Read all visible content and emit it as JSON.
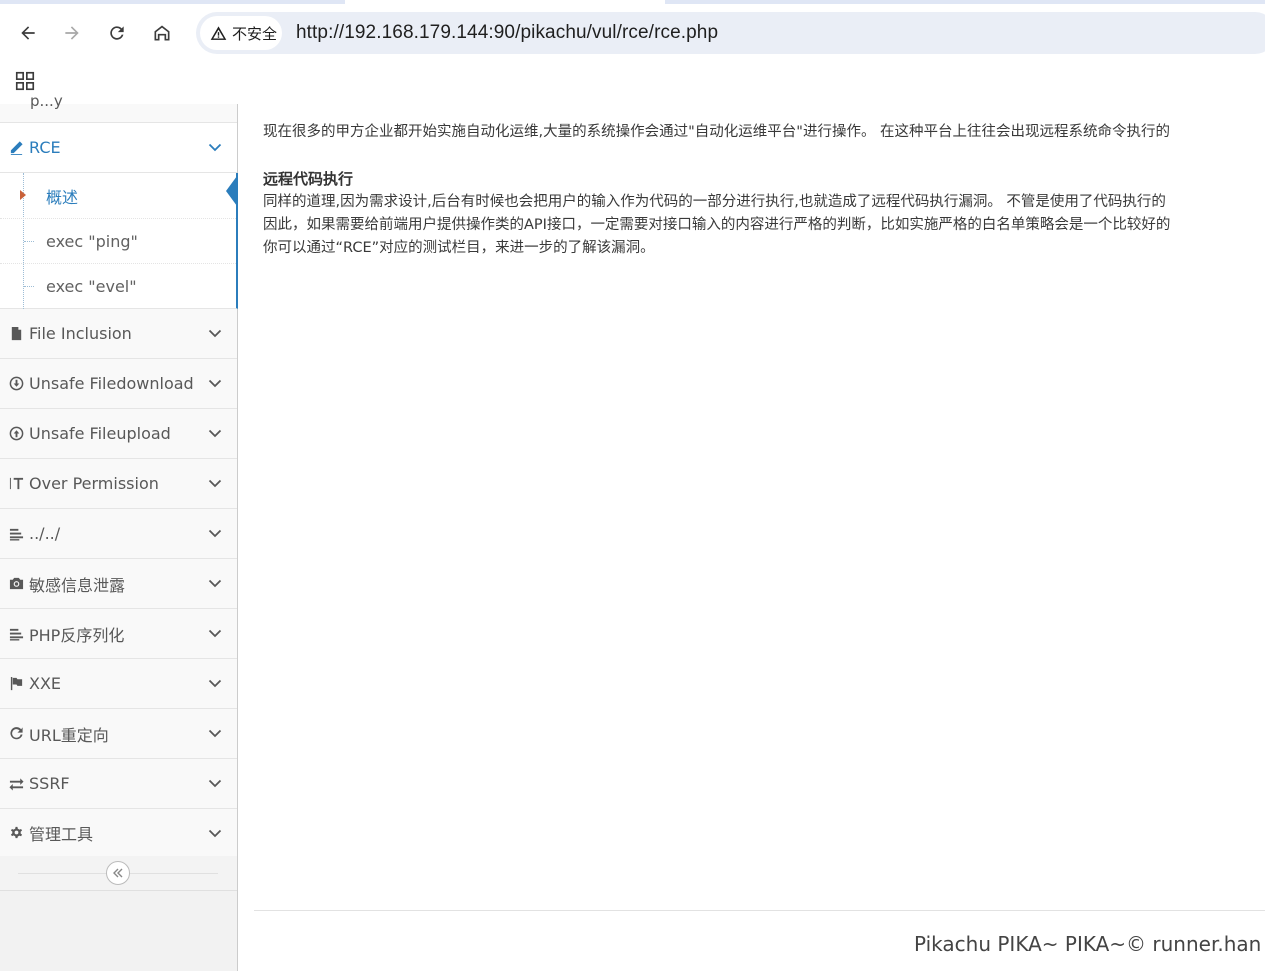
{
  "browser": {
    "security_label": "不安全",
    "url": "http://192.168.179.144:90/pikachu/vul/rce/rce.php"
  },
  "sidebar": {
    "partial_top_label": "p...y",
    "rce": {
      "label": "RCE"
    },
    "rce_subitems": [
      {
        "label": "概述"
      },
      {
        "label": "exec \"ping\""
      },
      {
        "label": "exec \"evel\""
      }
    ],
    "items": [
      {
        "label": "File Inclusion",
        "icon": "file-icon"
      },
      {
        "label": "Unsafe Filedownload",
        "icon": "download-circle-icon"
      },
      {
        "label": "Unsafe Fileupload",
        "icon": "upload-circle-icon"
      },
      {
        "label": "Over Permission",
        "icon": "text-height-icon"
      },
      {
        "label": "../../",
        "icon": "align-left-icon"
      },
      {
        "label": "敏感信息泄露",
        "icon": "camera-icon"
      },
      {
        "label": "PHP反序列化",
        "icon": "align-left-icon"
      },
      {
        "label": "XXE",
        "icon": "flag-icon"
      },
      {
        "label": "URL重定向",
        "icon": "refresh-icon"
      },
      {
        "label": "SSRF",
        "icon": "exchange-icon"
      },
      {
        "label": "管理工具",
        "icon": "cog-icon"
      }
    ]
  },
  "content": {
    "intro": "现在很多的甲方企业都开始实施自动化运维,大量的系统操作会通过\"自动化运维平台\"进行操作。 在这种平台上往往会出现远程系统命令执行的",
    "heading": "远程代码执行",
    "lines": [
      "同样的道理,因为需求设计,后台有时候也会把用户的输入作为代码的一部分进行执行,也就造成了远程代码执行漏洞。 不管是使用了代码执行的",
      "因此，如果需要给前端用户提供操作类的API接口，一定需要对接口输入的内容进行严格的判断，比如实施严格的白名单策略会是一个比较好的",
      "你可以通过“RCE”对应的测试栏目，来进一步的了解该漏洞。"
    ]
  },
  "footer": {
    "text": "Pikachu PIKA~ PIKA~© runner.han"
  },
  "colors": {
    "accent": "#2b7dbc",
    "caret": "#c86139"
  }
}
